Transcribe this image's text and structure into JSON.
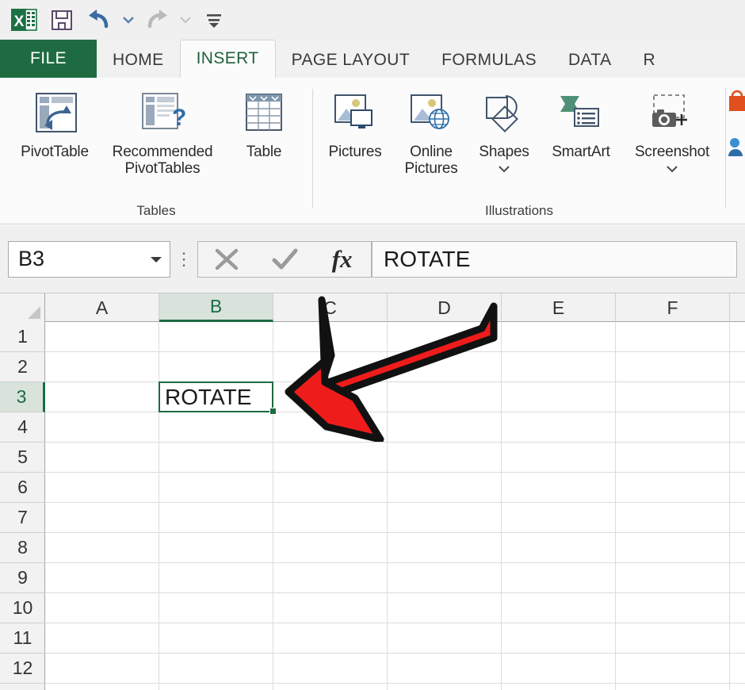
{
  "quick_access": {
    "app_icon": "excel-logo-icon",
    "buttons": [
      {
        "name": "save-button",
        "icon": "save-icon",
        "label": "Save"
      },
      {
        "name": "undo-button",
        "icon": "undo-icon",
        "label": "Undo"
      },
      {
        "name": "redo-button",
        "icon": "redo-icon",
        "label": "Redo"
      },
      {
        "name": "customize-qat-button",
        "icon": "customize-quick-access-toolbar-icon",
        "label": "Customize Quick Access Toolbar"
      }
    ]
  },
  "ribbon": {
    "tabs": [
      {
        "label": "FILE",
        "active": false,
        "file": true
      },
      {
        "label": "HOME",
        "active": false,
        "file": false
      },
      {
        "label": "INSERT",
        "active": true,
        "file": false
      },
      {
        "label": "PAGE LAYOUT",
        "active": false,
        "file": false
      },
      {
        "label": "FORMULAS",
        "active": false,
        "file": false
      },
      {
        "label": "DATA",
        "active": false,
        "file": false
      },
      {
        "label": "R",
        "active": false,
        "file": false
      }
    ],
    "groups": [
      {
        "label": "Tables",
        "items": [
          {
            "label": "PivotTable",
            "icon": "pivot-table-icon",
            "caret": false
          },
          {
            "label": "Recommended PivotTables",
            "icon": "recommended-pivot-tables-icon",
            "caret": false
          },
          {
            "label": "Table",
            "icon": "table-icon",
            "caret": false
          }
        ]
      },
      {
        "label": "Illustrations",
        "items": [
          {
            "label": "Pictures",
            "icon": "pictures-icon",
            "caret": false
          },
          {
            "label": "Online Pictures",
            "icon": "online-pictures-icon",
            "caret": false
          },
          {
            "label": "Shapes",
            "icon": "shapes-icon",
            "caret": true
          },
          {
            "label": "SmartArt",
            "icon": "smartart-icon",
            "caret": false
          },
          {
            "label": "Screenshot",
            "icon": "screenshot-icon",
            "caret": true
          }
        ]
      },
      {
        "label": "",
        "items": [
          {
            "label": "",
            "icon": "store-apps-icon",
            "caret": false
          },
          {
            "label": "",
            "icon": "my-apps-icon",
            "caret": false
          }
        ]
      }
    ]
  },
  "formula_bar": {
    "name_box_value": "B3",
    "name_box_placeholder": "Name Box",
    "cancel_label": "Cancel",
    "enter_label": "Enter",
    "fx_label": "fx",
    "formula_value": "ROTATE",
    "formula_placeholder": ""
  },
  "sheet": {
    "columns": [
      "A",
      "B",
      "C",
      "D",
      "E",
      "F"
    ],
    "selected_column": "B",
    "rows": [
      "1",
      "2",
      "3",
      "4",
      "5",
      "6",
      "7",
      "8",
      "9",
      "10",
      "11",
      "12"
    ],
    "selected_row": "3",
    "active_cell": "B3",
    "active_cell_value": "ROTATE"
  },
  "annotation": {
    "shape": "red-arrow-pointing-left",
    "color": "#ef1c1c",
    "outline_color": "#111111",
    "points_to": "B3"
  },
  "colors": {
    "file_tab_green": "#1e6b41",
    "selection_green": "#1d6b42",
    "ribbon_bg": "#fbfbfb",
    "chrome_bg": "#f0f0f0",
    "arrow_red": "#ef1c1c"
  }
}
